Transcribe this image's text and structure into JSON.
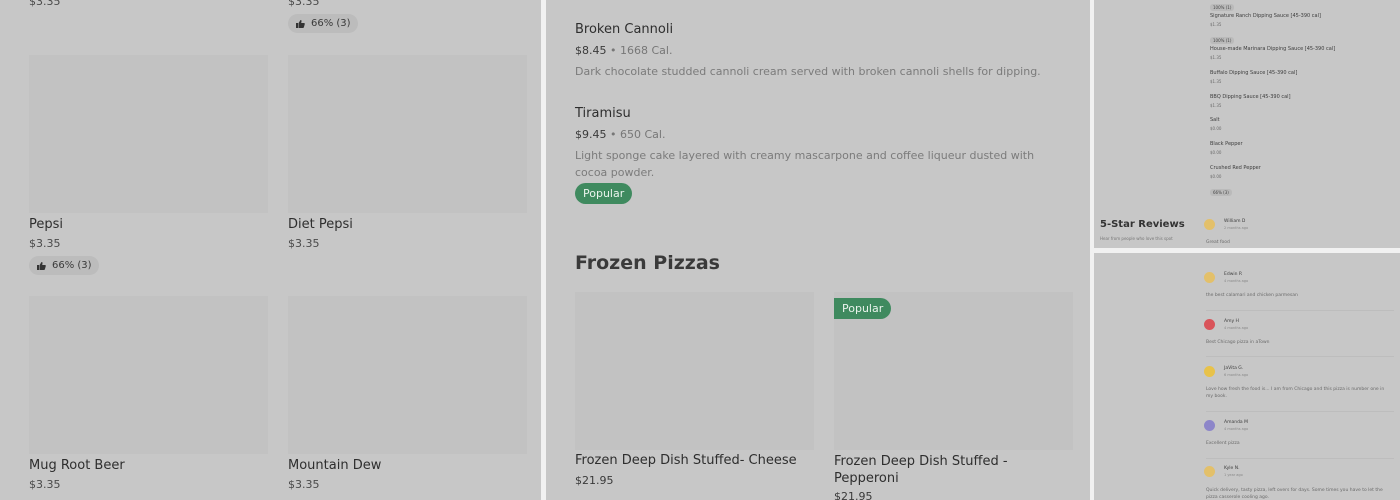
{
  "menu_drinks": {
    "top_prices": [
      "$3.35",
      "$3.35"
    ],
    "top_rating": "66% (3)",
    "items": [
      {
        "name": "Pepsi",
        "price": "$3.35",
        "rating": "66% (3)"
      },
      {
        "name": "Diet Pepsi",
        "price": "$3.35",
        "rating": ""
      },
      {
        "name": "Mug Root Beer",
        "price": "$3.35",
        "rating": ""
      },
      {
        "name": "Mountain Dew",
        "price": "$3.35",
        "rating": ""
      }
    ]
  },
  "desserts": [
    {
      "name": "Broken Cannoli",
      "price": "$8.45",
      "calories": "1668 Cal.",
      "description": "Dark chocolate studded cannoli cream served with broken cannoli shells for dipping.",
      "badge": ""
    },
    {
      "name": "Tiramisu",
      "price": "$9.45",
      "calories": "650 Cal.",
      "description": "Light sponge cake layered with creamy mascarpone and coffee liqueur dusted with cocoa powder.",
      "badge": "Popular"
    }
  ],
  "meta_separator": "•",
  "frozen_section": {
    "title": "Frozen Pizzas",
    "items": [
      {
        "name": "Frozen Deep Dish Stuffed- Cheese",
        "price": "$21.95",
        "badge": ""
      },
      {
        "name": "Frozen Deep Dish Stuffed - Pepperoni",
        "price": "$21.95",
        "badge": "Popular"
      }
    ]
  },
  "sauces": {
    "first_rating": "100% (1)",
    "items": [
      {
        "name": "Signature Ranch Dipping Sauce [45-390 cal]",
        "price": "$1.35",
        "rating": "100% (1)"
      },
      {
        "name": "House-made Marinara Dipping Sauce [45-390 cal]",
        "price": "$1.35",
        "rating": ""
      },
      {
        "name": "Buffalo Dipping Sauce [45-390 cal]",
        "price": "$1.35",
        "rating": ""
      },
      {
        "name": "BBQ Dipping Sauce [45-390 cal]",
        "price": "$1.35",
        "rating": ""
      },
      {
        "name": "Salt",
        "price": "$0.00",
        "rating": ""
      },
      {
        "name": "Black Pepper",
        "price": "$0.00",
        "rating": ""
      },
      {
        "name": "Crushed Red Pepper",
        "price": "$0.00",
        "rating": "66% (3)"
      }
    ]
  },
  "reviews_header": {
    "title": "5-Star Reviews",
    "subtitle": "Hear from people who love this spot"
  },
  "reviews": [
    {
      "name": "William D",
      "time": "2 months ago",
      "text": "Great food",
      "avatar_color": "#e3c06a"
    },
    {
      "name": "Edwin R",
      "time": "4 months ago",
      "text": "the best calamari and chicken parmesan",
      "avatar_color": "#e3c06a"
    },
    {
      "name": "Amy H",
      "time": "4 months ago",
      "text": "Best Chicago pizza in aTown",
      "avatar_color": "#d9545a"
    },
    {
      "name": "JaVita G.",
      "time": "6 months ago",
      "text": "Love how fresh the food is... I am from Chicago and this pizza is number one in my book.",
      "avatar_color": "#e8c24a"
    },
    {
      "name": "Amanda M",
      "time": "4 months ago",
      "text": "Excellent pizza",
      "avatar_color": "#8d86c9"
    },
    {
      "name": "Kyle N.",
      "time": "1 year ago",
      "text": "Quick delivery, tasty pizza, left overs for days. Some times you have to let the pizza casserole cooling ago.",
      "avatar_color": "#e3c06a"
    }
  ],
  "colors": {
    "popular_badge": "#3f8a5f",
    "panel_bg": "#c7c7c7"
  },
  "icons": {
    "rating": "thumbs-up-icon"
  }
}
